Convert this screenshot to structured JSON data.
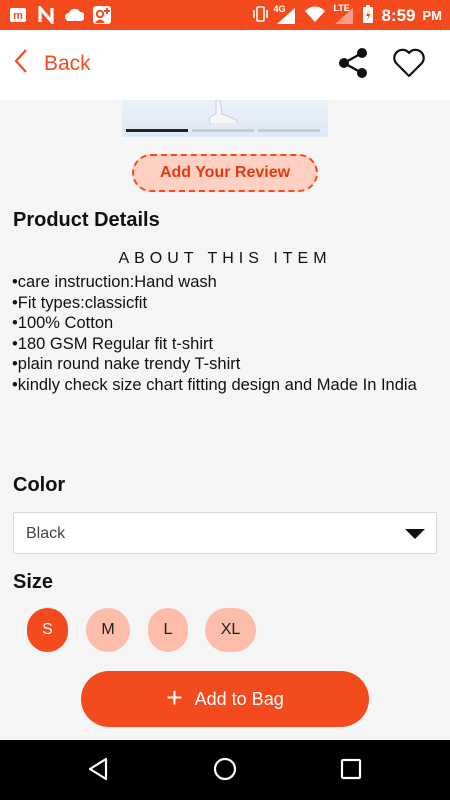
{
  "status_bar": {
    "time": "8:59",
    "ampm": "PM",
    "network_4g": "4G",
    "network_lte": "LTE",
    "left_icons": [
      "m-app-icon",
      "n-app-icon",
      "cloud-icon",
      "google-plus-icon"
    ],
    "accent": "#f44b1e"
  },
  "app_bar": {
    "back_label": "Back",
    "share_icon": "share-icon",
    "favorite_icon": "heart-icon"
  },
  "gallery": {
    "page_count": 3,
    "active_index": 0
  },
  "review": {
    "button_label": "Add Your Review"
  },
  "product_details": {
    "title": "Product Details",
    "about_heading": "ABOUT THIS ITEM",
    "bullets": [
      "•care instruction:Hand wash",
      "•Fit types:classicfit",
      "•100% Cotton",
      "•180 GSM Regular fit t-shirt",
      "•plain round nake trendy T-shirt",
      "•kindly check size  chart fitting design and Made In India"
    ]
  },
  "color": {
    "title": "Color",
    "selected": "Black"
  },
  "size": {
    "title": "Size",
    "options": [
      "S",
      "M",
      "L",
      "XL"
    ],
    "selected": "S"
  },
  "cart": {
    "add_to_bag_label": "Add to Bag"
  },
  "nav_bar": {
    "icons": [
      "back-triangle-icon",
      "home-circle-icon",
      "recents-square-icon"
    ]
  }
}
